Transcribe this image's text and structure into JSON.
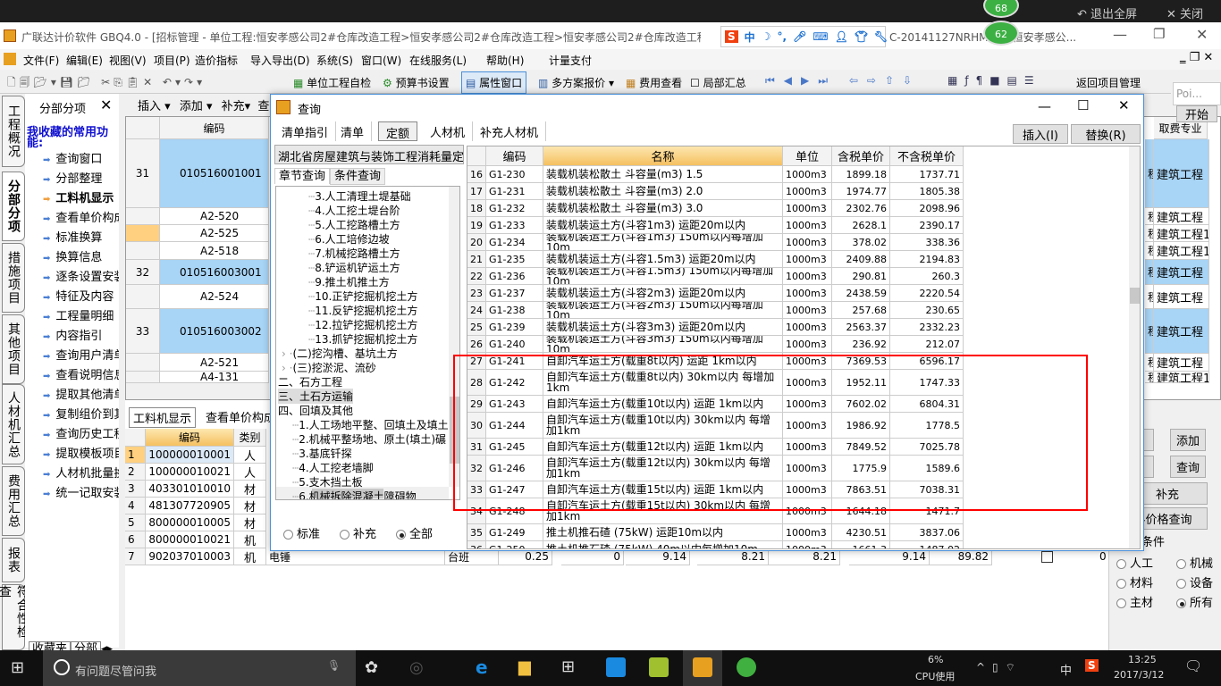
{
  "overlay": {
    "exit_fullscreen": "退出全屏",
    "close": "关闭",
    "badge_top": "68",
    "badge_bottom": "62"
  },
  "title": {
    "text": "广联达计价软件 GBQ4.0 - [招标管理 - 单位工程:恒安孝感公司2#仓库改造工程>恒安孝感公司2#仓库改造工程>恒安孝感公司2#仓库改造工程-",
    "text_right": "C-20141127NRHM\\...p\\恒安孝感公..."
  },
  "menu": [
    "文件(F)",
    "编辑(E)",
    "视图(V)",
    "项目(P)",
    "造价指标",
    "导入导出(D)",
    "系统(S)",
    "窗口(W)",
    "在线服务(L)",
    "帮助(H)",
    "计量支付"
  ],
  "toolbar": {
    "self_check": "单位工程自检",
    "budget_setting": "预算书设置",
    "property_window": "属性窗口",
    "multi_quote": "多方案报价",
    "cost_view": "费用查看",
    "partial_sum": "局部汇总",
    "return_project": "返回项目管理"
  },
  "vertical_tabs": [
    "工程概况",
    "分部分项",
    "措施项目",
    "其他项目",
    "人材机汇总",
    "费用汇总",
    "报表",
    "符合性检查"
  ],
  "left_panel": {
    "title": "分部分项",
    "heading": "我收藏的常用功能:",
    "items": [
      "查询窗口",
      "分部整理",
      "工料机显示",
      "查看单价构成",
      "标准换算",
      "换算信息",
      "逐条设置安装",
      "特征及内容",
      "工程量明细",
      "内容指引",
      "查询用户清单",
      "查看说明信息",
      "提取其他清单",
      "复制组价到其",
      "查询历史工程",
      "提取模板项目",
      "人材机批量换",
      "统一记取安装"
    ],
    "active_index": 2,
    "bottom_tabs": [
      "收藏夹",
      "分部"
    ]
  },
  "sub_toolbar": {
    "insert": "插入",
    "add": "添加",
    "supplement": "补充",
    "query": "查"
  },
  "main_grid": {
    "header_code": "编码",
    "header_fee": "取费专业",
    "rows": [
      {
        "num": "31",
        "code": "010516001001",
        "fee": "建筑工程",
        "parent": true
      },
      {
        "num": "",
        "code": "A2-520",
        "fee": "建筑工程"
      },
      {
        "num": "",
        "code": "A2-525",
        "fee": "建筑工程1"
      },
      {
        "num": "",
        "code": "A2-518",
        "fee": "建筑工程1"
      },
      {
        "num": "32",
        "code": "010516003001",
        "fee": "建筑工程",
        "parent": true
      },
      {
        "num": "",
        "code": "A2-524",
        "fee": "建筑工程"
      },
      {
        "num": "33",
        "code": "010516003002",
        "fee": "建筑工程",
        "parent": true
      },
      {
        "num": "",
        "code": "A2-521",
        "fee": "建筑工程"
      },
      {
        "num": "",
        "code": "A4-131",
        "fee": "建筑工程1"
      }
    ]
  },
  "bottom": {
    "tabs": [
      "工料机显示",
      "查看单价构成"
    ],
    "headers": [
      "编码",
      "类别"
    ],
    "rows": [
      {
        "num": "1",
        "code": "100000010001",
        "type": "人"
      },
      {
        "num": "2",
        "code": "100000010021",
        "type": "人"
      },
      {
        "num": "3",
        "code": "403301010010",
        "type": "材"
      },
      {
        "num": "4",
        "code": "481307720905",
        "type": "材"
      },
      {
        "num": "5",
        "code": "800000010005",
        "type": "材"
      },
      {
        "num": "6",
        "code": "800000010021",
        "type": "机"
      },
      {
        "num": "7",
        "code": "902037010003",
        "type": "机"
      }
    ],
    "row7_extra": {
      "name": "电锤",
      "unit": "台班",
      "values": [
        "0.25",
        "0",
        "9.14",
        "8.21",
        "8.21",
        "9.14",
        "89.82"
      ],
      "last": "0"
    }
  },
  "right_panel": {
    "poi": "Poi...",
    "start": "开始",
    "buttons": [
      "入",
      "添加",
      "除",
      "查询",
      "补充",
      "料价格查询"
    ],
    "condition_label": "条件",
    "radios": [
      "人工",
      "机械",
      "材料",
      "设备",
      "主材",
      "所有"
    ],
    "selected": "所有"
  },
  "dialog": {
    "title": "查询",
    "tabs": [
      "清单指引",
      "清单",
      "定额",
      "人材机",
      "补充人材机"
    ],
    "active_tab": "定额",
    "insert": "插入(I)",
    "replace": "替换(R)",
    "library": "湖北省房屋建筑与装饰工程消耗量定",
    "sub_tabs": [
      "章节查询",
      "条件查询"
    ],
    "tree": [
      {
        "t": "3.人工清理土堤基础",
        "l": 3
      },
      {
        "t": "4.人工挖土堤台阶",
        "l": 3
      },
      {
        "t": "5.人工挖路槽土方",
        "l": 3
      },
      {
        "t": "6.人工培修边坡",
        "l": 3
      },
      {
        "t": "7.机械挖路槽土方",
        "l": 3
      },
      {
        "t": "8.铲运机铲运土方",
        "l": 3
      },
      {
        "t": "9.推土机推土方",
        "l": 3
      },
      {
        "t": "10.正铲挖掘机挖土方",
        "l": 3
      },
      {
        "t": "11.反铲挖掘机挖土方",
        "l": 3
      },
      {
        "t": "12.拉铲挖掘机挖土方",
        "l": 3
      },
      {
        "t": "13.抓铲挖掘机挖土方",
        "l": 3
      },
      {
        "t": "(二)挖沟槽、基坑土方",
        "l": 1
      },
      {
        "t": "(三)挖淤泥、流砂",
        "l": 1
      },
      {
        "t": "二、石方工程",
        "l": 0
      },
      {
        "t": "三、土石方运输",
        "l": 0,
        "sel": true
      },
      {
        "t": "四、回填及其他",
        "l": 0
      },
      {
        "t": "1.人工场地平整、回填土及填土",
        "l": 2
      },
      {
        "t": "2.机械平整场地、原土(填土)碾",
        "l": 2
      },
      {
        "t": "3.基底钎探",
        "l": 2
      },
      {
        "t": "4.人工挖老墙脚",
        "l": 2
      },
      {
        "t": "5.支木挡土板",
        "l": 2
      },
      {
        "t": "6.机械拆除混凝土障碍物",
        "l": 2
      }
    ],
    "filters": [
      "标准",
      "补充",
      "全部"
    ],
    "filter_selected": "全部",
    "columns": [
      "",
      "编码",
      "名称",
      "单位",
      "含税单价",
      "不含税单价"
    ],
    "rows": [
      [
        "16",
        "G1-230",
        "装载机装松散土 斗容量(m3) 1.5",
        "1000m3",
        "1899.18",
        "1737.71"
      ],
      [
        "17",
        "G1-231",
        "装载机装松散土 斗容量(m3) 2.0",
        "1000m3",
        "1974.77",
        "1805.38"
      ],
      [
        "18",
        "G1-232",
        "装载机装松散土 斗容量(m3) 3.0",
        "1000m3",
        "2302.76",
        "2098.96"
      ],
      [
        "19",
        "G1-233",
        "装载机装运土方(斗容1m3) 运距20m以内",
        "1000m3",
        "2628.1",
        "2390.17"
      ],
      [
        "20",
        "G1-234",
        "装载机装运土方(斗容1m3) 150m以内每增加10m",
        "1000m3",
        "378.02",
        "338.36"
      ],
      [
        "21",
        "G1-235",
        "装载机装运土方(斗容1.5m3) 运距20m以内",
        "1000m3",
        "2409.88",
        "2194.83"
      ],
      [
        "22",
        "G1-236",
        "装载机装运土方(斗容1.5m3) 150m以内每增加10m",
        "1000m3",
        "290.81",
        "260.3"
      ],
      [
        "23",
        "G1-237",
        "装载机装运土方(斗容2m3) 运距20m以内",
        "1000m3",
        "2438.59",
        "2220.54"
      ],
      [
        "24",
        "G1-238",
        "装载机装运土方(斗容2m3) 150m以内每增加10m",
        "1000m3",
        "257.68",
        "230.65"
      ],
      [
        "25",
        "G1-239",
        "装载机装运土方(斗容3m3) 运距20m以内",
        "1000m3",
        "2563.37",
        "2332.23"
      ],
      [
        "26",
        "G1-240",
        "装载机装运土方(斗容3m3) 150m以内每增加10m",
        "1000m3",
        "236.92",
        "212.07"
      ],
      [
        "27",
        "G1-241",
        "自卸汽车运土方(载重8t以内) 运距 1km以内",
        "1000m3",
        "7369.53",
        "6596.17"
      ],
      [
        "28",
        "G1-242",
        "自卸汽车运土方(载重8t以内) 30km以内 每增加1km",
        "1000m3",
        "1952.11",
        "1747.33"
      ],
      [
        "29",
        "G1-243",
        "自卸汽车运土方(载重10t以内) 运距 1km以内",
        "1000m3",
        "7602.02",
        "6804.31"
      ],
      [
        "30",
        "G1-244",
        "自卸汽车运土方(载重10t以内) 30km以内 每增加1km",
        "1000m3",
        "1986.92",
        "1778.5"
      ],
      [
        "31",
        "G1-245",
        "自卸汽车运土方(载重12t以内) 运距 1km以内",
        "1000m3",
        "7849.52",
        "7025.78"
      ],
      [
        "32",
        "G1-246",
        "自卸汽车运土方(载重12t以内) 30km以内 每增加1km",
        "1000m3",
        "1775.9",
        "1589.6"
      ],
      [
        "33",
        "G1-247",
        "自卸汽车运土方(载重15t以内) 运距 1km以内",
        "1000m3",
        "7863.51",
        "7038.31"
      ],
      [
        "34",
        "G1-248",
        "自卸汽车运土方(载重15t以内) 30km以内 每增加1km",
        "1000m3",
        "1644.18",
        "1471.7"
      ],
      [
        "35",
        "G1-249",
        "推土机推石碴 (75kW) 运距10m以内",
        "1000m3",
        "4230.51",
        "3837.06"
      ],
      [
        "36",
        "G1-250",
        "推土机推石碴 (75kW) 40m以内每增加10m",
        "1000m3",
        "1661.3",
        "1487.02"
      ]
    ],
    "double_rows": [
      "28",
      "30",
      "32",
      "34"
    ],
    "highlight_color": "#ff0000"
  },
  "taskbar": {
    "search": "有问题尽管问我",
    "cpu": "6%",
    "cpu_label": "CPU使用",
    "ime": "中",
    "time": "13:25",
    "date": "2017/3/12"
  }
}
